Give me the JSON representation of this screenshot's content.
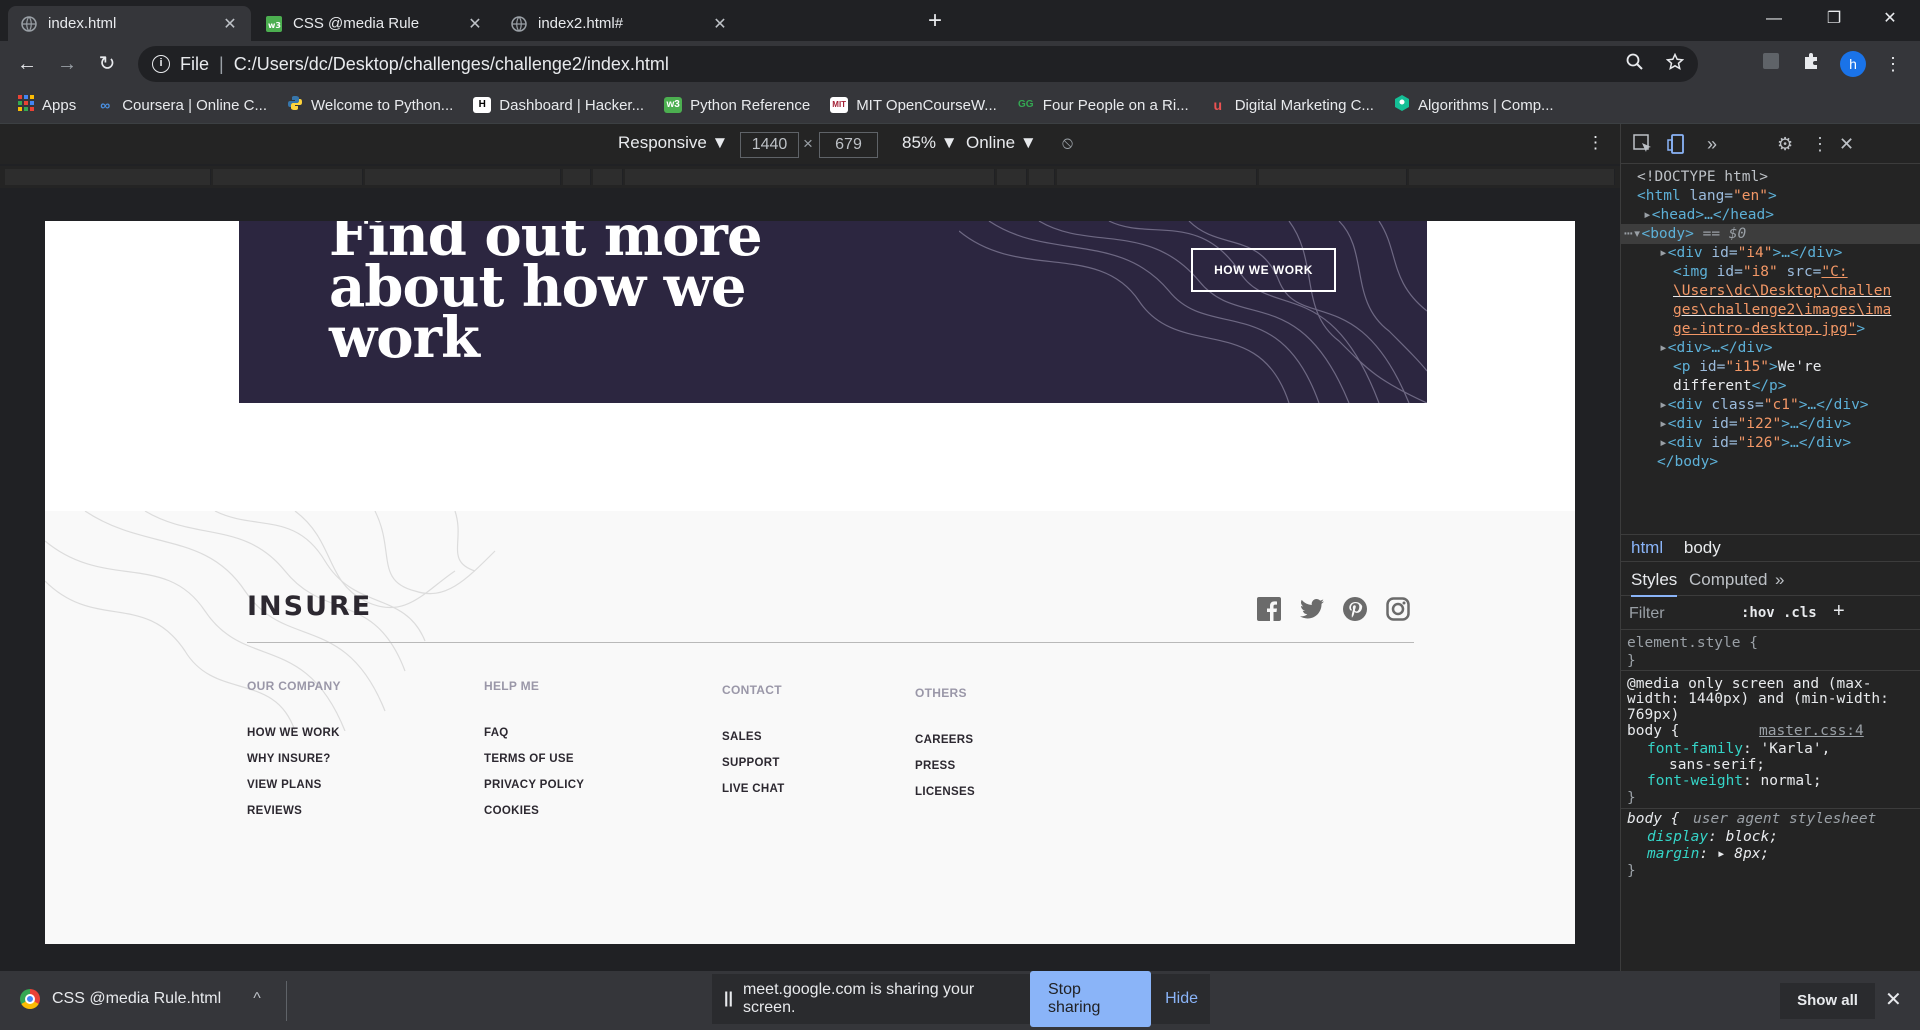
{
  "tabs": [
    {
      "title": "index.html",
      "close": "✕"
    },
    {
      "title": "CSS @media Rule",
      "close": "✕"
    },
    {
      "title": "index2.html#",
      "close": "✕"
    }
  ],
  "newtab": "+",
  "window": {
    "minimize": "—",
    "restore": "❐",
    "close": "✕"
  },
  "nav": {
    "back": "←",
    "forward": "→",
    "reload": "↻"
  },
  "omnibox": {
    "info": "i",
    "scheme": "File",
    "separator": "|",
    "url": "C:/Users/dc/Desktop/challenges/challenge2/index.html"
  },
  "profile": {
    "initial": "h"
  },
  "bookmarks": [
    {
      "label": "Apps",
      "icon": "apps-grid-icon"
    },
    {
      "label": "Coursera | Online C...",
      "icon": "coursera-icon"
    },
    {
      "label": "Welcome to Python...",
      "icon": "python-icon"
    },
    {
      "label": "Dashboard | Hacker...",
      "icon": "hackerrank-icon"
    },
    {
      "label": "Python Reference",
      "icon": "w3-icon"
    },
    {
      "label": "MIT OpenCourseW...",
      "icon": "mit-icon"
    },
    {
      "label": "Four People on a Ri...",
      "icon": "gg-icon"
    },
    {
      "label": "Digital Marketing C...",
      "icon": "udemy-icon"
    },
    {
      "label": "Algorithms | Comp...",
      "icon": "khan-icon"
    }
  ],
  "device_toolbar": {
    "mode": "Responsive ▼",
    "width": "1440",
    "times": "×",
    "height": "679",
    "zoom": "85% ▼",
    "network": "Online ▼",
    "rotate_icon": "⦸",
    "more": "⋮"
  },
  "page": {
    "banner_heading": "Find out more\nabout how we work",
    "banner_button": "HOW WE WORK",
    "logo": "INSURE",
    "columns": [
      {
        "heading": "OUR COMPANY",
        "links": [
          "HOW WE WORK",
          "WHY INSURE?",
          "VIEW PLANS",
          "REVIEWS"
        ]
      },
      {
        "heading": "HELP ME",
        "links": [
          "FAQ",
          "TERMS OF USE",
          "PRIVACY POLICY",
          "COOKIES"
        ]
      },
      {
        "heading": "CONTACT",
        "links": [
          "SALES",
          "SUPPORT",
          "LIVE CHAT"
        ]
      },
      {
        "heading": "OTHERS",
        "links": [
          "CAREERS",
          "PRESS",
          "LICENSES"
        ]
      }
    ]
  },
  "devtools": {
    "dom": {
      "doctype": "<!DOCTYPE html>",
      "html_open_tag": "<html",
      "html_lang_attr": " lang=",
      "html_lang_val": "\"en\"",
      "html_open_close": ">",
      "head": "<head>…</head>",
      "body": "<body>",
      "body_marker": " == $0",
      "div_i4_open": "<div",
      "div_i4_attr": " id=",
      "div_i4_val": "\"i4\"",
      "div_i4_close": ">…</div>",
      "img_open": "<img",
      "img_id_attr": " id=",
      "img_id_val": "\"i8\"",
      "img_src_attr": " src=",
      "img_src_1": "\"C:",
      "img_src_2": "\\Users\\dc\\Desktop\\challen",
      "img_src_3": "ges\\challenge2\\images\\ima",
      "img_src_4": "ge-intro-desktop.jpg\"",
      "img_close": ">",
      "div_plain": "<div>…</div>",
      "p_open": "<p",
      "p_attr": " id=",
      "p_val": "\"i15\"",
      "p_text1_gt": ">",
      "p_text1": "We're",
      "p_text2": "different",
      "p_close": "</p>",
      "div_c1_open": "<div",
      "div_c1_attr": " class=",
      "div_c1_val": "\"c1\"",
      "div_c1_close": ">…</div>",
      "div_i22_open": "<div",
      "div_i22_attr": " id=",
      "div_i22_val": "\"i22\"",
      "div_i22_close": ">…</div>",
      "div_i26_open": "<div",
      "div_i26_attr": " id=",
      "div_i26_val": "\"i26\"",
      "div_i26_close": ">…</div>",
      "body_close": "</body>"
    },
    "breadcrumbs": [
      "html",
      "body"
    ],
    "tabs": {
      "styles": "Styles",
      "computed": "Computed",
      "more": "»"
    },
    "filter": {
      "placeholder": "Filter",
      "hov": ":hov",
      "cls": ".cls",
      "add": "+"
    },
    "rules": {
      "element_style": "element.style {",
      "close_brace": "}",
      "media_1": "@media only screen and (max-",
      "media_2": "width: 1440px) and (min-width:",
      "media_3": "769px)",
      "body_selector": "body {",
      "source": "master.css:4",
      "ff_prop": "font-family",
      "ff_val": ": 'Karla',",
      "ff_val2": "sans-serif;",
      "fw_prop": "font-weight",
      "fw_val": ": normal;",
      "ua_selector": "body {",
      "ua_label": "user agent stylesheet",
      "display_prop": "display",
      "display_val": ": block;",
      "margin_prop": "margin",
      "margin_val": ": ▸ 8px;"
    }
  },
  "downloads": {
    "file": "CSS @media Rule.html",
    "chevron": "^",
    "show_all": "Show all",
    "close": "✕"
  },
  "share_bar": {
    "pause": "||",
    "message": "meet.google.com is sharing your screen.",
    "stop": "Stop sharing",
    "hide": "Hide"
  },
  "colors": {
    "banner_bg": "#2c2640",
    "accent": "#8ab4f8",
    "footer_bg": "#f9f9f9"
  }
}
